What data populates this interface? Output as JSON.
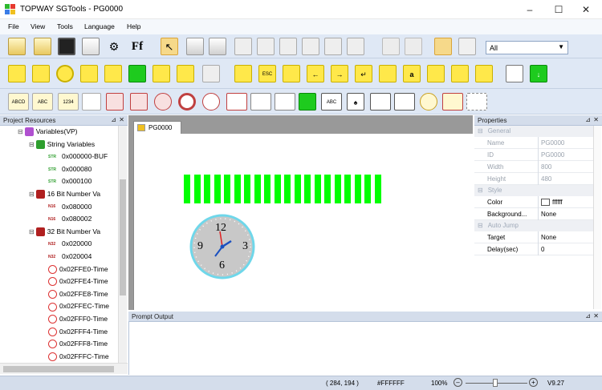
{
  "window": {
    "title": "TOPWAY SGTools - PG0000"
  },
  "menu": {
    "file": "File",
    "view": "View",
    "tools": "Tools",
    "language": "Language",
    "help": "Help"
  },
  "toolbar": {
    "layer_select": "All"
  },
  "project_panel": {
    "title": "Project Resources",
    "tree": [
      {
        "label": "Variables(VP)",
        "badge": "",
        "level": 0
      },
      {
        "label": "String Variables",
        "badge": "",
        "level": 1
      },
      {
        "label": "0x000000-BUF",
        "badge": "STR",
        "level": 2
      },
      {
        "label": "0x000080",
        "badge": "STR",
        "level": 2
      },
      {
        "label": "0x000100",
        "badge": "STR",
        "level": 2
      },
      {
        "label": "16 Bit Number Va",
        "badge": "",
        "level": 1
      },
      {
        "label": "0x080000",
        "badge": "N16",
        "level": 2
      },
      {
        "label": "0x080002",
        "badge": "N16",
        "level": 2
      },
      {
        "label": "32 Bit Number Va",
        "badge": "",
        "level": 1
      },
      {
        "label": "0x020000",
        "badge": "N32",
        "level": 2
      },
      {
        "label": "0x020004",
        "badge": "N32",
        "level": 2
      },
      {
        "label": "0x02FFE0-Time",
        "badge": "",
        "level": 2
      },
      {
        "label": "0x02FFE4-Time",
        "badge": "",
        "level": 2
      },
      {
        "label": "0x02FFE8-Time",
        "badge": "",
        "level": 2
      },
      {
        "label": "0x02FFEC-Time",
        "badge": "",
        "level": 2
      },
      {
        "label": "0x02FFF0-Time",
        "badge": "",
        "level": 2
      },
      {
        "label": "0x02FFF4-Time",
        "badge": "",
        "level": 2
      },
      {
        "label": "0x02FFF8-Time",
        "badge": "",
        "level": 2
      },
      {
        "label": "0x02FFFC-Time",
        "badge": "",
        "level": 2
      }
    ]
  },
  "canvas": {
    "tab": "PG0000",
    "progress_segments": 20,
    "clock_numbers": {
      "top": "12",
      "right": "3",
      "bottom": "6",
      "left": "9"
    }
  },
  "properties": {
    "title": "Properties",
    "sections": [
      {
        "name": "General",
        "rows": [
          {
            "key": "Name",
            "value": "PG0000"
          },
          {
            "key": "ID",
            "value": "PG0000"
          },
          {
            "key": "Width",
            "value": "800"
          },
          {
            "key": "Height",
            "value": "480"
          }
        ]
      },
      {
        "name": "Style",
        "rows": [
          {
            "key": "Color",
            "value": "ffffff"
          },
          {
            "key": "Background...",
            "value": "None"
          }
        ]
      },
      {
        "name": "Auto Jump",
        "rows": [
          {
            "key": "Target",
            "value": "None"
          },
          {
            "key": "Delay(sec)",
            "value": "0"
          }
        ]
      }
    ]
  },
  "output_panel": {
    "title": "Prompt Output"
  },
  "status": {
    "coords": "( 284, 194 )",
    "color": "#FFFFFF",
    "zoom": "100%",
    "version": "V9.27"
  },
  "colors": {
    "accent": "#00ff00",
    "panel": "#d4ddeb",
    "toolbar": "#dfe8f5"
  }
}
